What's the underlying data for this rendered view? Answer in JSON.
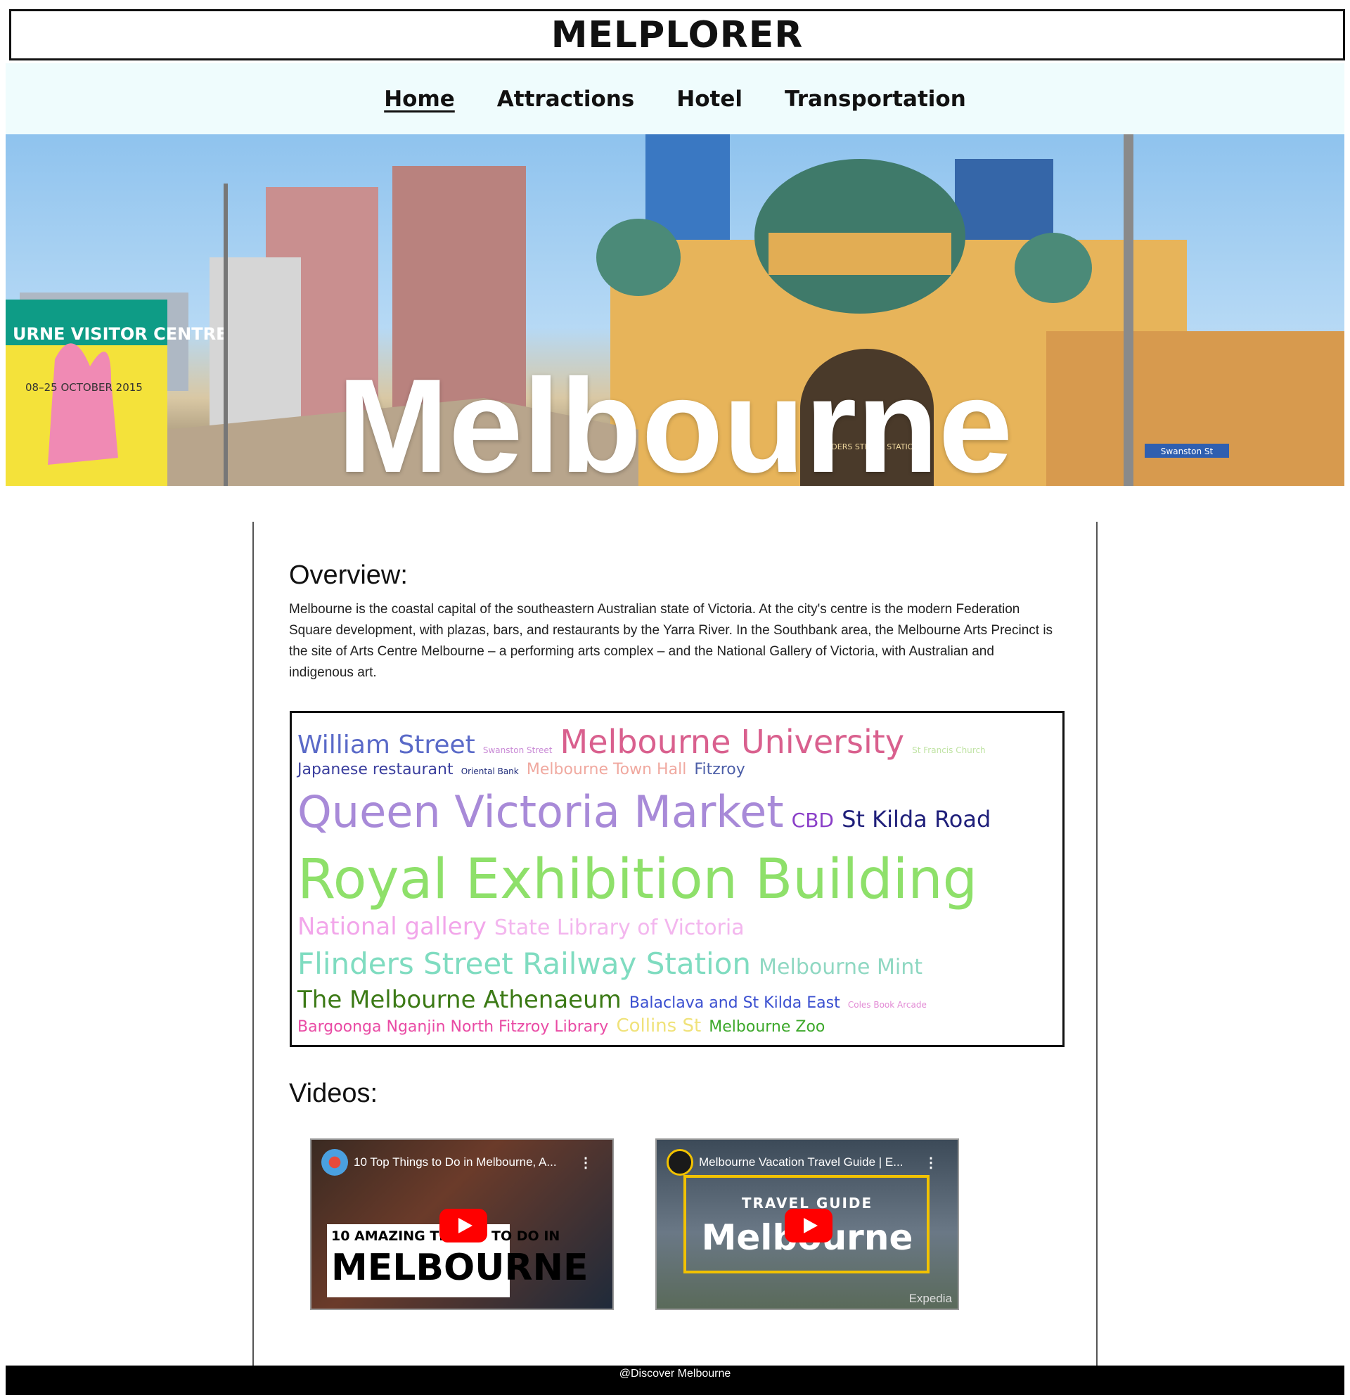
{
  "brand": "MELPLORER",
  "nav": {
    "items": [
      "Home",
      "Attractions",
      "Hotel",
      "Transportation"
    ],
    "active": "Home"
  },
  "hero": {
    "title": "Melbourne",
    "sign_text": "URNE VISITOR CENTRE",
    "poster_text": "08–25 OCTOBER 2015",
    "station_text": "FLINDERS STREET STATION",
    "street_sign": "Swanston St"
  },
  "overview": {
    "heading": "Overview:",
    "text": "Melbourne is the coastal capital of the southeastern Australian state of Victoria. At the city's centre is the modern Federation Square development, with plazas, bars, and restaurants by the Yarra River. In the Southbank area, the Melbourne Arts Precinct is the site of Arts Centre Melbourne – a performing arts complex – and the National Gallery of Victoria, with Australian and indigenous art."
  },
  "word_cloud": {
    "lines": [
      [
        {
          "text": "William Street",
          "color": "#5a6ac8"
        },
        {
          "text": "Swanston Street",
          "color": "#c98ad6"
        },
        {
          "text": "Melbourne University",
          "color": "#d9608e"
        },
        {
          "text": "St Francis Church",
          "color": "#bfe3a3"
        }
      ],
      [
        {
          "text": "Japanese restaurant",
          "color": "#3b3f9e"
        },
        {
          "text": "Oriental Bank",
          "color": "#1f2b7a"
        },
        {
          "text": "Melbourne Town Hall",
          "color": "#f0a9a0"
        },
        {
          "text": "Fitzroy",
          "color": "#4d5fa8"
        }
      ],
      [
        {
          "text": "Queen Victoria Market",
          "color": "#a88ad8"
        },
        {
          "text": "CBD",
          "color": "#8a3fc8"
        },
        {
          "text": "St Kilda Road",
          "color": "#1f1f7a"
        }
      ],
      [
        {
          "text": "Royal Exhibition Building",
          "color": "#8ee06a"
        }
      ],
      [
        {
          "text": "National gallery",
          "color": "#f2a6ea"
        },
        {
          "text": "State Library of Victoria",
          "color": "#f3b6ee"
        }
      ],
      [
        {
          "text": "Flinders Street Railway Station",
          "color": "#7fdcc0"
        },
        {
          "text": "Melbourne Mint",
          "color": "#8fd8c2"
        }
      ],
      [
        {
          "text": "The Melbourne Athenaeum",
          "color": "#3c7a16"
        },
        {
          "text": "Balaclava and St Kilda East",
          "color": "#3a4fd0"
        },
        {
          "text": "Coles Book Arcade",
          "color": "#e28ad4"
        }
      ],
      [
        {
          "text": "Bargoonga Nganjin North Fitzroy Library",
          "color": "#e94aa4"
        },
        {
          "text": "Collins St",
          "color": "#f0e27a"
        },
        {
          "text": "Melbourne Zoo",
          "color": "#3ca82a"
        }
      ]
    ]
  },
  "videos": {
    "heading": "Videos:",
    "items": [
      {
        "title": "10 Top Things to Do in Melbourne, A...",
        "thumb_line1": "10 AMAZING THINGS TO DO IN",
        "thumb_line2": "MELBOURNE"
      },
      {
        "title": "Melbourne Vacation Travel Guide | E...",
        "thumb_line1": "TRAVEL GUIDE",
        "thumb_line2": "Melbourne",
        "watermark": "Expedia"
      }
    ]
  },
  "footer": {
    "text": "@Discover Melbourne"
  }
}
